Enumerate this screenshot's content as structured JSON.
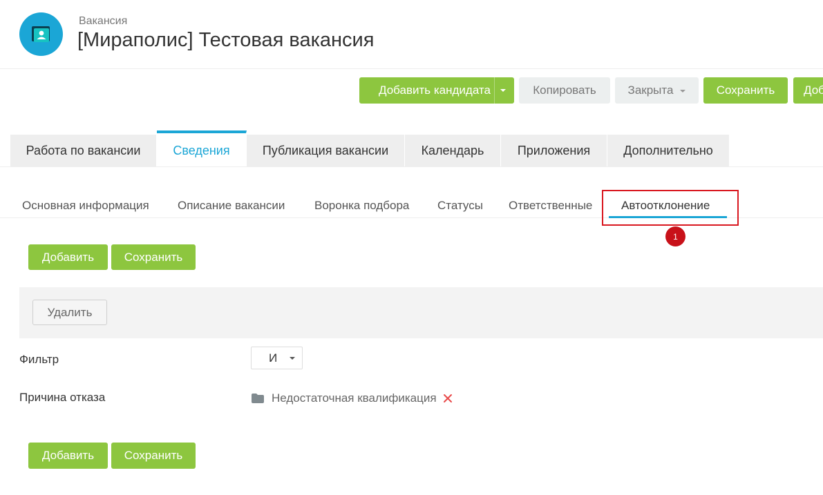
{
  "header": {
    "subtitle": "Вакансия",
    "title": "[Мираполис] Тестовая вакансия",
    "avatar_icon": "contact-card-icon",
    "accent_color": "#1ba6d6"
  },
  "toolbar": {
    "add_candidate_label": "Добавить кандидата",
    "copy_label": "Копировать",
    "status_label": "Закрыта",
    "save_label": "Сохранить",
    "cut_off_label": "Доб",
    "button_color": "#8dc63f"
  },
  "tabs": [
    {
      "label": "Работа по вакансии"
    },
    {
      "label": "Сведения"
    },
    {
      "label": "Публикация вакансии"
    },
    {
      "label": "Календарь"
    },
    {
      "label": "Приложения"
    },
    {
      "label": "Дополнительно"
    }
  ],
  "active_tab": "Сведения",
  "subtabs": [
    {
      "label": "Основная информация"
    },
    {
      "label": "Описание вакансии"
    },
    {
      "label": "Воронка подбора"
    },
    {
      "label": "Статусы"
    },
    {
      "label": "Ответственные"
    },
    {
      "label": "Автоотклонение"
    }
  ],
  "active_subtab": "Автоотклонение",
  "annotation": {
    "number": "1",
    "color": "#c81119"
  },
  "actions_top": {
    "add_label": "Добавить",
    "save_label": "Сохранить"
  },
  "panel": {
    "delete_label": "Удалить"
  },
  "form": {
    "filter_label": "Фильтр",
    "filter_value": "И",
    "reason_label": "Причина отказа",
    "reason_value": "Недостаточная квалификация",
    "reason_icon": "folder-icon",
    "remove_icon": "close-icon"
  },
  "actions_bottom": {
    "add_label": "Добавить",
    "save_label": "Сохранить"
  }
}
